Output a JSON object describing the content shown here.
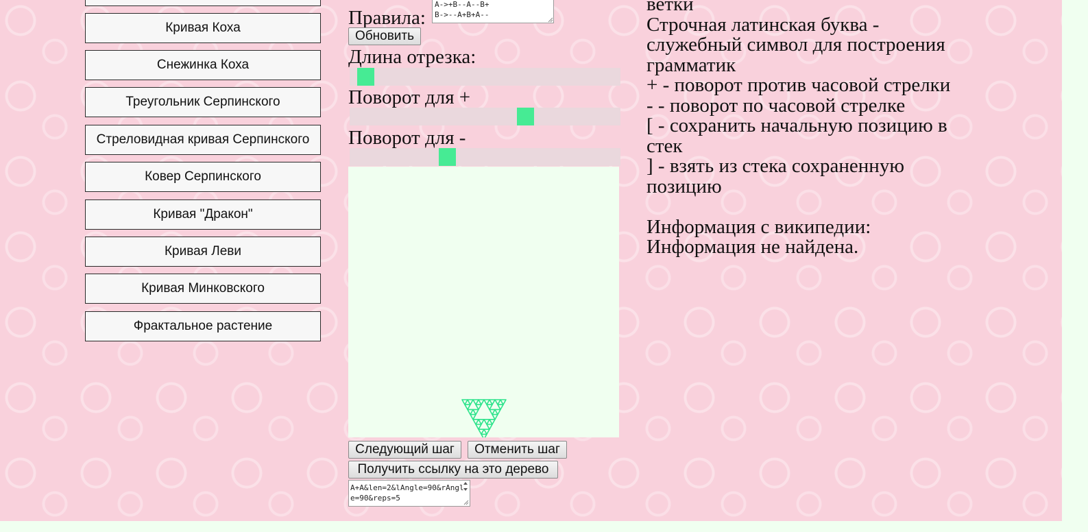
{
  "menu": {
    "items": [
      {
        "label": "Кривая Коха"
      },
      {
        "label": "Снежинка Коха"
      },
      {
        "label": "Треугольник Серпинского"
      },
      {
        "label": "Стреловидная кривая Серпинского"
      },
      {
        "label": "Ковер Серпинского"
      },
      {
        "label": "Кривая \"Дракон\""
      },
      {
        "label": "Кривая Леви"
      },
      {
        "label": "Кривая Минковского"
      },
      {
        "label": "Фрактальное растение"
      }
    ]
  },
  "editor": {
    "rules_label": "Правила:",
    "rules_value": "A->+B--A--B+\nB->--A+B+A--",
    "update_button": "Обновить",
    "length_label": "Длина отрезка:",
    "length_slider": {
      "value": 0.03
    },
    "plus_label": "Поворот для +",
    "plus_slider": {
      "value": 0.66
    },
    "minus_label": "Поворот для -",
    "minus_slider": {
      "value": 0.35
    },
    "next_step_button": "Следующий шаг",
    "undo_step_button": "Отменить шаг",
    "get_link_button": "Получить ссылку на это дерево",
    "link_value": "A+A&len=2&lAngle=90&rAngle=90&reps=5"
  },
  "colors": {
    "accent": "#46eb94",
    "fractal": "#2ee38c",
    "canvas_bg": "#f0fff0",
    "page_bg": "#f9d1dc"
  },
  "info": {
    "lines": [
      "ветки",
      "Строчная латинская буква -",
      "служебный символ для построения",
      "грамматик",
      "+ - поворот против часовой стрелки",
      "- - поворот по часовой стрелке",
      "[ - сохранить начальную позицию в",
      "стек",
      "] - взять из стека сохраненную",
      "позицию"
    ],
    "wiki_title": "Информация с википедии:",
    "wiki_text": "Информация не найдена."
  }
}
